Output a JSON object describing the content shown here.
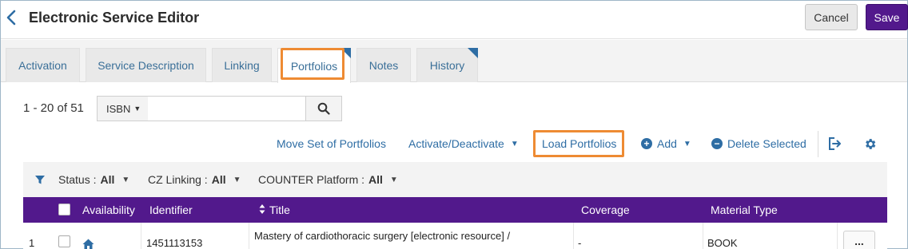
{
  "header": {
    "title": "Electronic Service Editor",
    "cancel_label": "Cancel",
    "save_label": "Save"
  },
  "tabs": [
    {
      "label": "Activation",
      "active": false
    },
    {
      "label": "Service Description",
      "active": false
    },
    {
      "label": "Linking",
      "active": false
    },
    {
      "label": "Portfolios",
      "active": true
    },
    {
      "label": "Notes",
      "active": false
    },
    {
      "label": "History",
      "active": false
    }
  ],
  "search": {
    "count_text": "1 - 20 of 51",
    "type_label": "ISBN",
    "value": "",
    "placeholder": ""
  },
  "actions": {
    "move_set": "Move Set of Portfolios",
    "activate": "Activate/Deactivate",
    "load": "Load Portfolios",
    "add": "Add",
    "delete": "Delete Selected"
  },
  "filters": [
    {
      "label": "Status :",
      "value": "All"
    },
    {
      "label": "CZ Linking :",
      "value": "All"
    },
    {
      "label": "COUNTER Platform :",
      "value": "All"
    }
  ],
  "table": {
    "columns": [
      "Availability",
      "Identifier",
      "Title",
      "Coverage",
      "Material Type"
    ],
    "rows": [
      {
        "index": "1",
        "identifier": "1451113153",
        "title": "Mastery of cardiothoracic surgery [electronic resource] /",
        "coverage": "-",
        "material_type": "BOOK",
        "actions": "..."
      }
    ]
  },
  "colors": {
    "primary": "#52198c",
    "link": "#2e6da4",
    "highlight": "#ee8b33"
  },
  "icons": [
    "chevron-left-icon",
    "search-icon",
    "caret-down-icon",
    "plus-circle-icon",
    "minus-circle-icon",
    "export-icon",
    "gear-icon",
    "filter-icon",
    "sort-icon",
    "home-icon"
  ]
}
